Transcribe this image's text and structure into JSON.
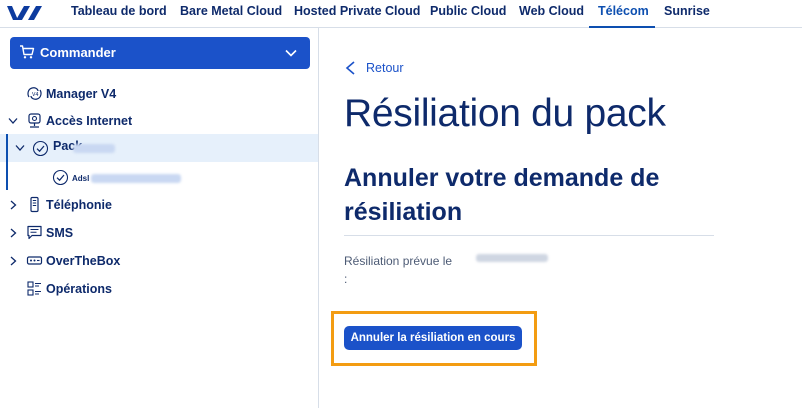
{
  "nav": {
    "items": [
      {
        "label": "Tableau de bord"
      },
      {
        "label": "Bare Metal Cloud"
      },
      {
        "label": "Hosted Private Cloud"
      },
      {
        "label": "Public Cloud"
      },
      {
        "label": "Web Cloud"
      },
      {
        "label": "Télécom",
        "active": true
      },
      {
        "label": "Sunrise"
      }
    ]
  },
  "sidebar": {
    "order_label": "Commander",
    "tree": [
      {
        "label": "Manager V4",
        "icon": "manager-v4-icon"
      },
      {
        "label": "Accès Internet",
        "icon": "internet-access-icon",
        "expanded": true
      },
      {
        "label": "Pack",
        "icon": "check-circle-icon",
        "selected": true
      },
      {
        "label": "Adsl",
        "icon": "check-circle-icon"
      },
      {
        "label": "Téléphonie",
        "icon": "phone-icon"
      },
      {
        "label": "SMS",
        "icon": "sms-icon"
      },
      {
        "label": "OverTheBox",
        "icon": "overthebox-icon"
      },
      {
        "label": "Opérations",
        "icon": "operations-icon"
      }
    ]
  },
  "main": {
    "back_label": "Retour",
    "page_title": "Résiliation du pack",
    "section_title": "Annuler votre demande de résiliation",
    "field_label": "Résiliation prévue le :",
    "cancel_button": "Annuler la résiliation en cours"
  },
  "colors": {
    "accent": "#1b52c9",
    "navy": "#0e2a6b",
    "highlight": "#f39c12"
  }
}
